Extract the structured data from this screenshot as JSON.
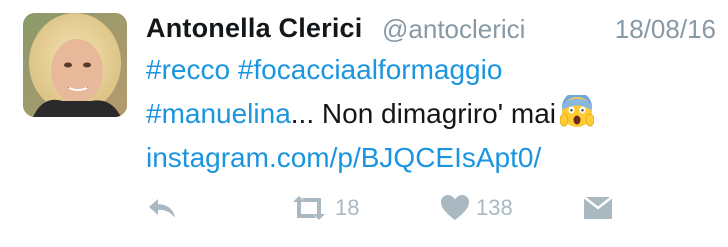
{
  "tweet": {
    "display_name": "Antonella Clerici",
    "handle": "@antoclerici",
    "timestamp": "18/08/16",
    "hashtag_recco": "#recco",
    "hashtag_focaccia": "#focacciaalformaggio",
    "hashtag_manuelina": "#manuelina",
    "text_after": "... Non dimagriro' mai",
    "emoji": "face-screaming-in-fear",
    "link": "instagram.com/p/BJQCEIsApt0/"
  },
  "actions": {
    "reply_icon": "reply-icon",
    "retweet_icon": "retweet-icon",
    "retweet_count": "18",
    "like_icon": "heart-icon",
    "like_count": "138",
    "dm_icon": "envelope-icon"
  },
  "colors": {
    "link": "#1b95e0",
    "text": "#14171a",
    "muted": "#8899a6",
    "icon": "#aab8c2"
  }
}
